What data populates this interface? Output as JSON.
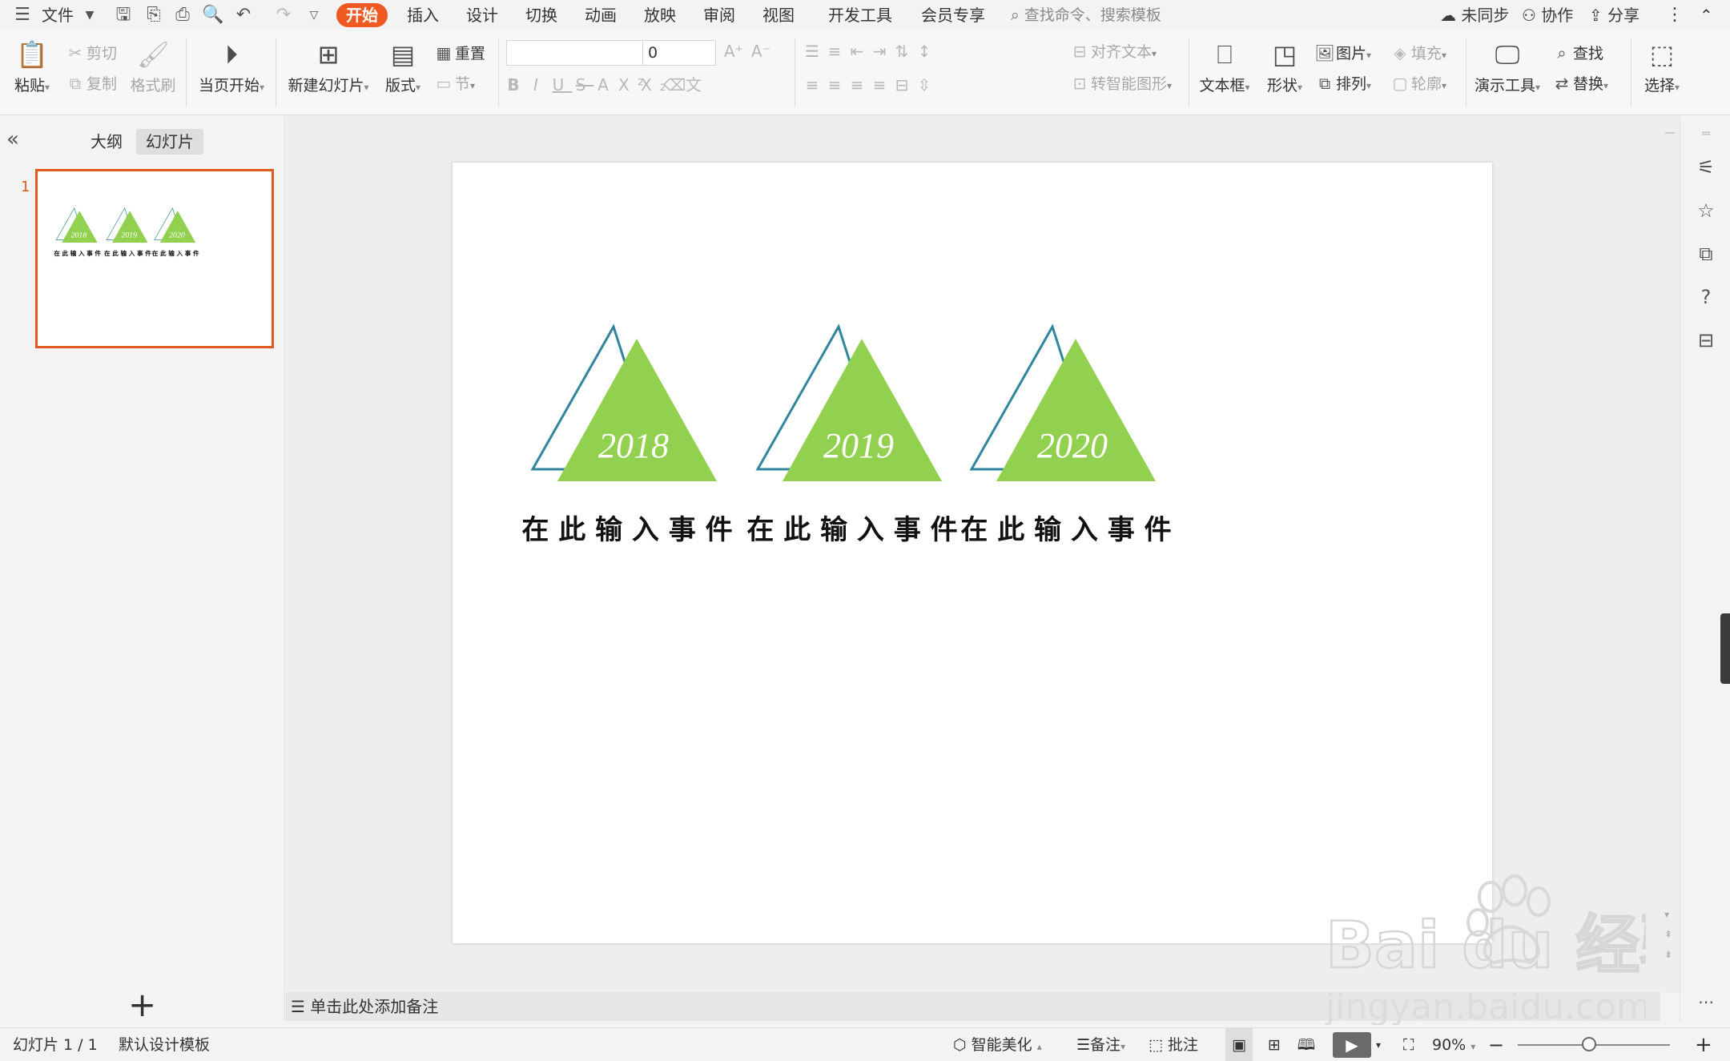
{
  "menubar": {
    "file": "文件",
    "tabs": [
      "开始",
      "插入",
      "设计",
      "切换",
      "动画",
      "放映",
      "审阅",
      "视图",
      "开发工具",
      "会员专享"
    ],
    "search_placeholder": "查找命令、搜索模板",
    "sync": "未同步",
    "collab": "协作",
    "share": "分享"
  },
  "ribbon": {
    "paste": "粘贴",
    "cut": "剪切",
    "copy": "复制",
    "format_painter": "格式刷",
    "from_current": "当页开始",
    "new_slide": "新建幻灯片",
    "layout": "版式",
    "reset": "重置",
    "section": "节",
    "font_name": "",
    "font_size": "0",
    "align_text": "对齐文本",
    "smartart": "转智能图形",
    "textbox": "文本框",
    "shape": "形状",
    "picture": "图片",
    "fill": "填充",
    "arrange": "排列",
    "outline": "轮廓",
    "present_tools": "演示工具",
    "find": "查找",
    "replace": "替换",
    "select": "选择"
  },
  "leftpanel": {
    "outline_tab": "大纲",
    "slides_tab": "幻灯片",
    "slide_number": "1"
  },
  "slide": {
    "items": [
      {
        "year": "2018",
        "event": "在 此 输 入 事 件"
      },
      {
        "year": "2019",
        "event": "在 此 输 入 事 件"
      },
      {
        "year": "2020",
        "event": "在 此 输 入 事 件"
      }
    ],
    "colors": {
      "fill": "#92d050",
      "outline": "#31859c"
    }
  },
  "notes": {
    "placeholder": "单击此处添加备注"
  },
  "statusbar": {
    "slide_counter": "幻灯片 1 / 1",
    "template": "默认设计模板",
    "beautify": "智能美化",
    "notes": "备注",
    "comments": "批注",
    "zoom": "90%"
  },
  "watermark": {
    "brand": "Bai du 经验",
    "url": "jingyan.baidu.com"
  }
}
